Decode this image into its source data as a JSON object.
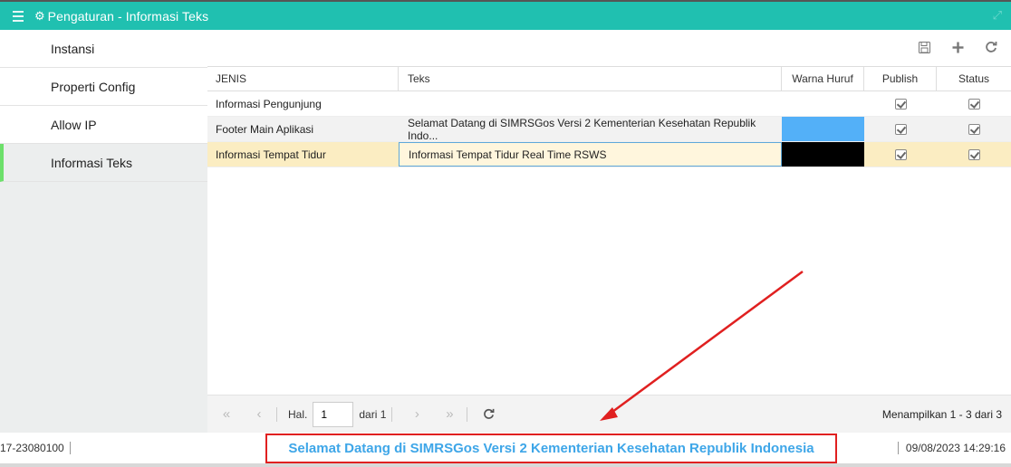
{
  "titlebar": {
    "menu_icon": "menu-icon",
    "gear_icon": "gear-icon",
    "title": "Pengaturan - Informasi Teks",
    "maximize_icon": "expand-icon"
  },
  "sidebar": {
    "items": [
      {
        "label": "Instansi",
        "active": false
      },
      {
        "label": "Properti Config",
        "active": false
      },
      {
        "label": "Allow IP",
        "active": false
      },
      {
        "label": "Informasi Teks",
        "active": true
      }
    ]
  },
  "toolbar": {
    "save_icon": "save-icon",
    "add_icon": "plus-icon",
    "refresh_icon": "refresh-icon"
  },
  "grid": {
    "headers": {
      "jenis": "JENIS",
      "teks": "Teks",
      "warna": "Warna Huruf",
      "publish": "Publish",
      "status": "Status"
    },
    "rows": [
      {
        "jenis": "Informasi Pengunjung",
        "teks": "",
        "warna": "",
        "publish": true,
        "status": true
      },
      {
        "jenis": "Footer Main Aplikasi",
        "teks": "Selamat Datang di SIMRSGos Versi 2 Kementerian Kesehatan Republik Indo...",
        "warna": "#53b0f8",
        "publish": true,
        "status": true
      },
      {
        "jenis": "Informasi Tempat Tidur",
        "teks": "Informasi Tempat Tidur Real Time RSWS",
        "warna": "#000000",
        "publish": true,
        "status": true
      }
    ]
  },
  "pager": {
    "page_label": "Hal.",
    "page_value": "1",
    "of_label": "dari 1",
    "info": "Menampilkan 1 - 3 dari 3"
  },
  "statusbar": {
    "left": "17-23080100",
    "marquee": "Selamat Datang di SIMRSGos Versi 2 Kementerian Kesehatan Republik Indonesia",
    "datetime": "09/08/2023 14:29:16"
  },
  "colors": {
    "accent": "#20c0b0",
    "active_indicator": "#6de06b",
    "selected_row": "#fbedc2",
    "marquee_text": "#3ea6e8",
    "annotation": "#e02020"
  }
}
